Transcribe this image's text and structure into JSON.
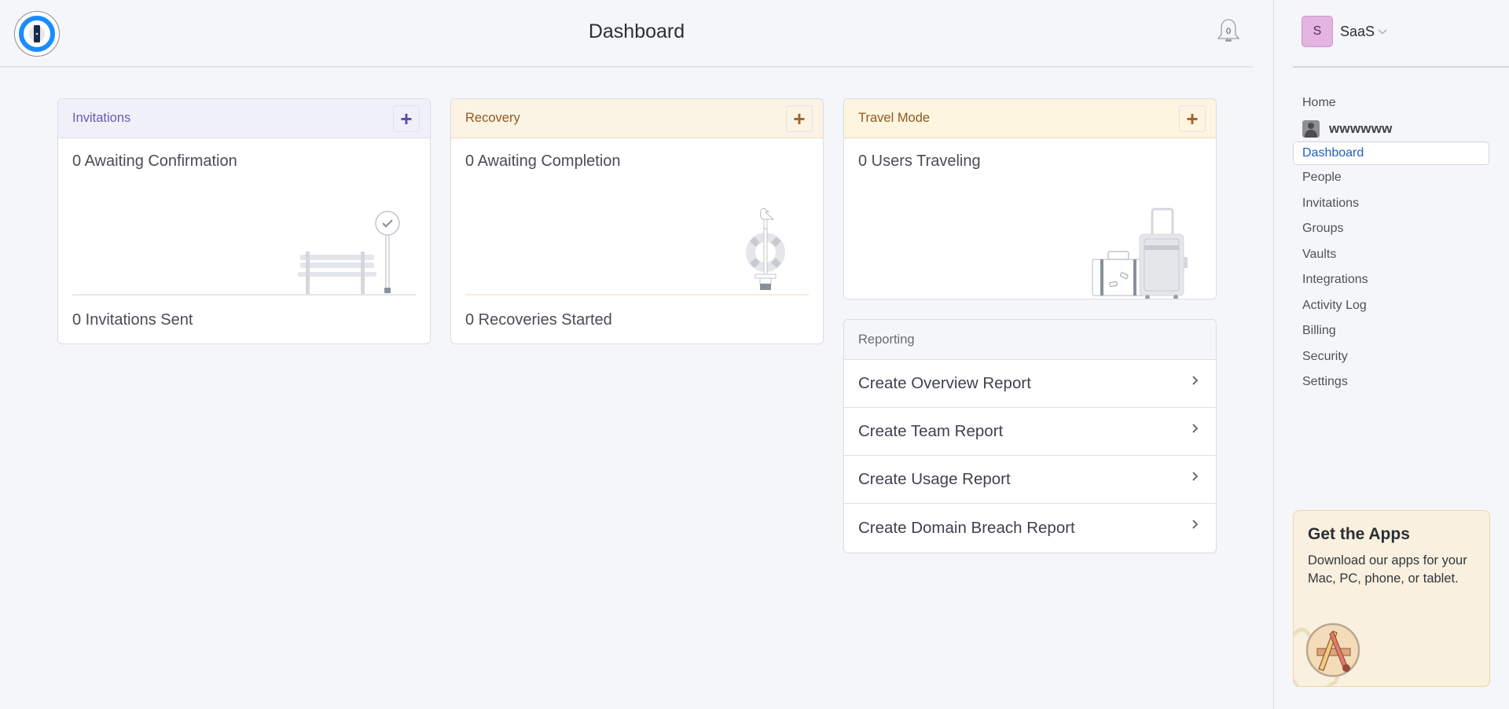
{
  "header": {
    "title": "Dashboard",
    "notifications_count": "0"
  },
  "account": {
    "avatar_letter": "S",
    "name": "SaaS",
    "avatar_color": "#e3b3e2"
  },
  "nav": {
    "items": [
      {
        "label": "Home"
      },
      {
        "label": "wwwwww",
        "type": "user"
      },
      {
        "label": "Dashboard",
        "active": true
      },
      {
        "label": "People"
      },
      {
        "label": "Invitations"
      },
      {
        "label": "Groups"
      },
      {
        "label": "Vaults"
      },
      {
        "label": "Integrations"
      },
      {
        "label": "Activity Log"
      },
      {
        "label": "Billing"
      },
      {
        "label": "Security"
      },
      {
        "label": "Settings"
      }
    ]
  },
  "apps_promo": {
    "title": "Get the Apps",
    "text": "Download our apps for your Mac, PC, phone, or tablet."
  },
  "cards": {
    "invitations": {
      "title": "Invitations",
      "stat_top": "0 Awaiting Confirmation",
      "stat_bottom": "0 Invitations Sent",
      "accent": "#6a5bae"
    },
    "recovery": {
      "title": "Recovery",
      "stat_top": "0 Awaiting Completion",
      "stat_bottom": "0 Recoveries Started",
      "accent": "#a0622a"
    },
    "travel": {
      "title": "Travel Mode",
      "stat_top": "0 Users Traveling",
      "accent": "#a0622a"
    },
    "reporting": {
      "title": "Reporting",
      "items": [
        {
          "label": "Create Overview Report"
        },
        {
          "label": "Create Team Report"
        },
        {
          "label": "Create Usage Report"
        },
        {
          "label": "Create Domain Breach Report"
        }
      ]
    }
  },
  "icons": {
    "plus": "+"
  }
}
